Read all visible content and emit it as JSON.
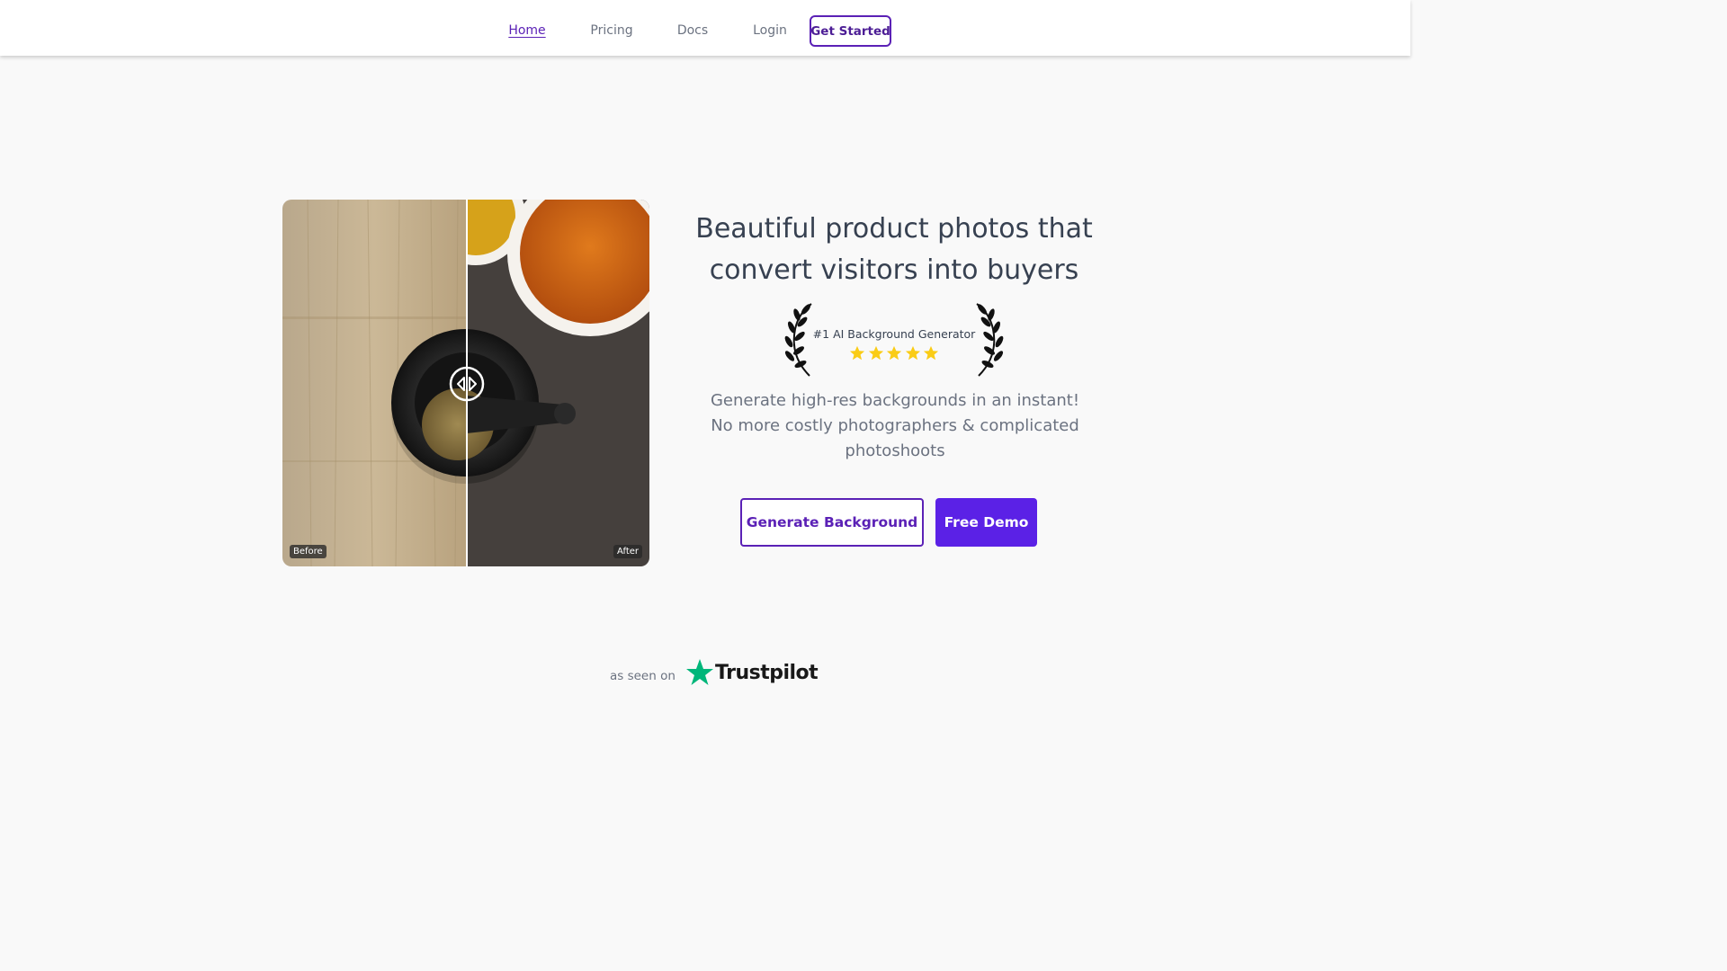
{
  "nav": {
    "links": [
      {
        "label": "Home",
        "active": true
      },
      {
        "label": "Pricing",
        "active": false
      },
      {
        "label": "Docs",
        "active": false
      },
      {
        "label": "Login",
        "active": false
      }
    ],
    "cta_label": "Get Started"
  },
  "compare": {
    "before_label": "Before",
    "after_label": "After",
    "handle_icon": "arrows-left-right-icon"
  },
  "hero": {
    "title_line1": "Beautiful product photos that",
    "title_line2": "convert visitors into buyers",
    "award_text": "#1 AI Background Generator",
    "rating_stars": 5,
    "sub_line1": "Generate high-res backgrounds in an instant!",
    "sub_line2": "No more costly photographers & complicated",
    "sub_line3": "photoshoots",
    "primary_button": "Generate Background",
    "secondary_button": "Free Demo"
  },
  "trust": {
    "prefix": "as seen on",
    "brand": "Trustpilot"
  },
  "colors": {
    "accent": "#5b21b6",
    "button_fill": "#5b21e6",
    "star": "#facc15",
    "trustpilot_green": "#00b67a"
  }
}
